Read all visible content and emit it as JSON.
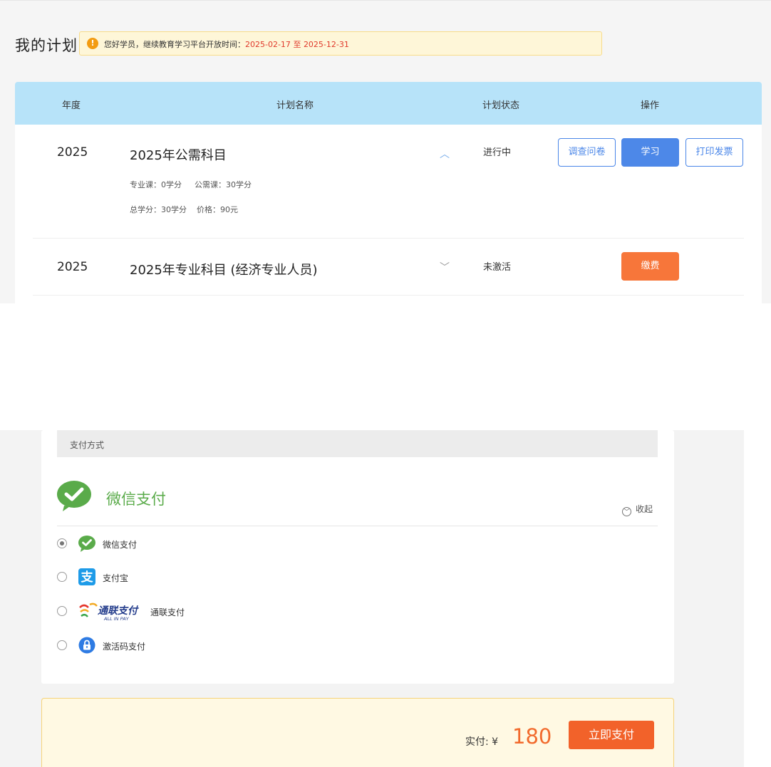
{
  "plans": {
    "title": "我的计划",
    "notice": {
      "text": "您好学员，继续教育学习平台开放时间：",
      "start": "2025-02-17",
      "separator": "至",
      "end": "2025-12-31"
    },
    "columns": [
      "年度",
      "计划名称",
      "计划状态",
      "操作"
    ],
    "rows": [
      {
        "year": "2025",
        "name": "2025年公需科目",
        "expanded": true,
        "professional": "专业课：0学分",
        "public": "公需课：30学分",
        "total": "总学分：30学分",
        "price": "价格：90元",
        "status": "进行中",
        "actions": [
          "调查问卷",
          "学习",
          "打印发票"
        ]
      },
      {
        "year": "2025",
        "name": "2025年专业科目 (经济专业人员)",
        "expanded": false,
        "status": "未激活",
        "actions": [
          "缴费"
        ]
      }
    ]
  },
  "payment": {
    "header": "支付方式",
    "selected_title": "微信支付",
    "collapse_label": "收起",
    "options": [
      {
        "label": "微信支付",
        "icon": "wechat-pay-icon",
        "checked": true
      },
      {
        "label": "支付宝",
        "icon": "alipay-icon",
        "checked": false
      },
      {
        "label": "通联支付",
        "icon": "allinpay-logo",
        "logo_text": "通联支付",
        "logo_sub": "ALL IN PAY",
        "checked": false
      },
      {
        "label": "激活码支付",
        "icon": "lock-icon",
        "checked": false
      }
    ],
    "total_label": "实付: ¥",
    "total_value": "180",
    "pay_button": "立即支付"
  },
  "colors": {
    "header_blue": "#b7e3f9",
    "primary_blue": "#4d88e8",
    "orange": "#f7763a",
    "wechat_green": "#5aab4a",
    "alipay_blue": "#1e9be8",
    "price_red": "#f26a2c"
  }
}
